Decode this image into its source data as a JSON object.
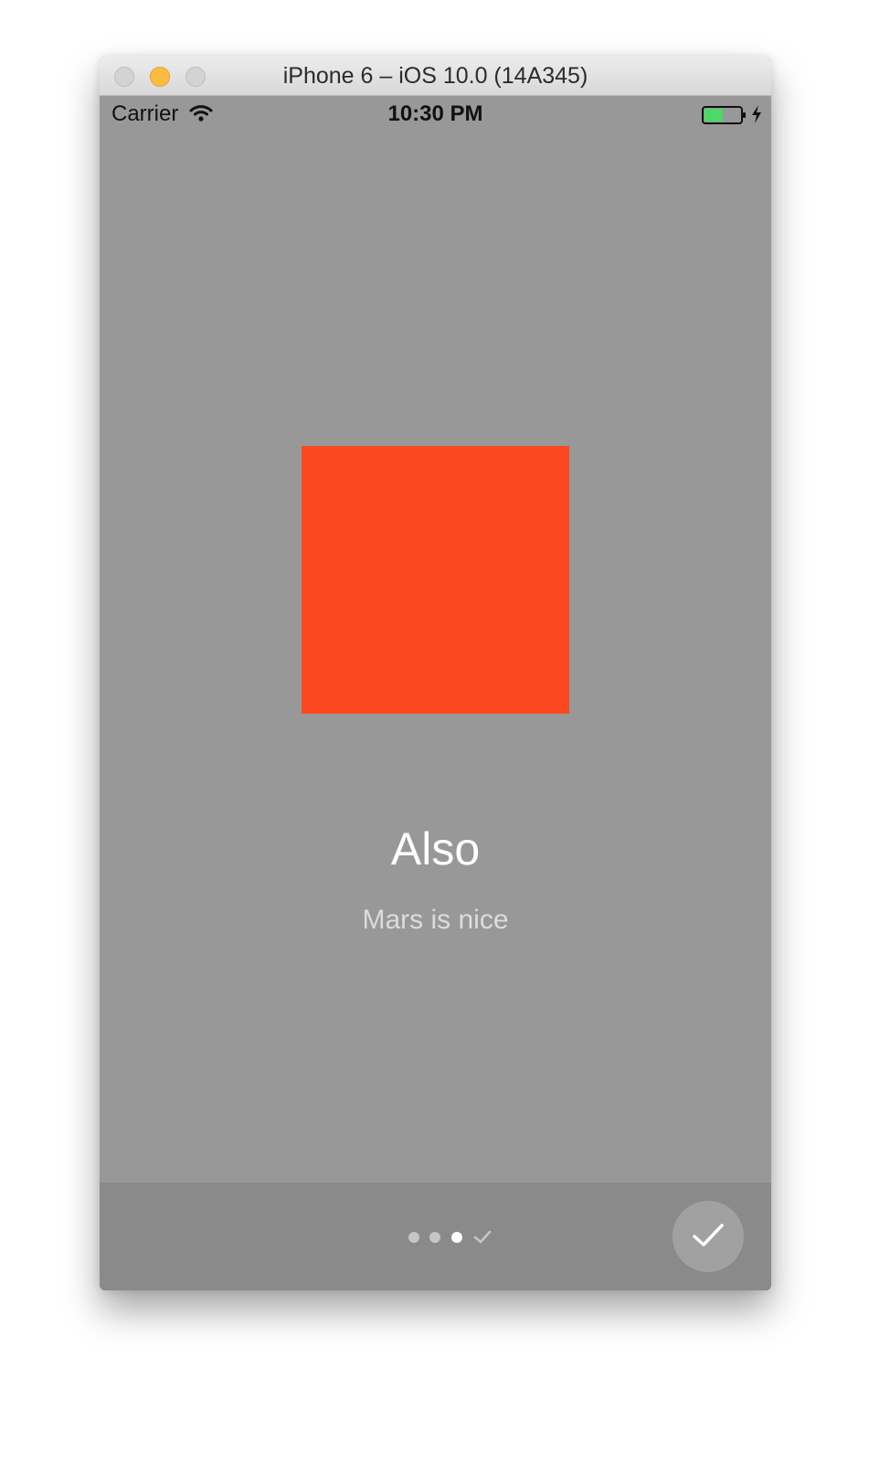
{
  "window": {
    "title": "iPhone 6 – iOS 10.0 (14A345)",
    "buttons": [
      "close",
      "minimize",
      "zoom"
    ]
  },
  "status_bar": {
    "carrier": "Carrier",
    "time": "10:30 PM",
    "wifi_icon": "wifi-icon",
    "battery_icon": "battery-icon",
    "charging_icon": "charging-bolt-icon"
  },
  "slide": {
    "image_color": "#fc4820",
    "title": "Also",
    "subtitle": "Mars is nice"
  },
  "pager": {
    "page_count": 4,
    "current_page": 3,
    "last_page_icon": "checkmark-icon"
  },
  "done_button": {
    "icon": "checkmark-icon"
  },
  "colors": {
    "background": "#989898",
    "bottom_bar": "#8a8a8a",
    "accent": "#fc4820"
  }
}
